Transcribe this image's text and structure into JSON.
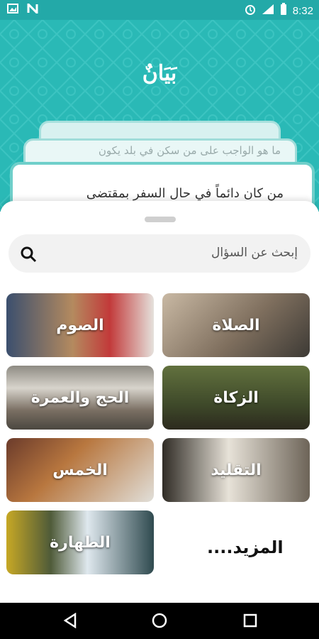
{
  "status": {
    "time": "8:32",
    "network": "LTE"
  },
  "header": {
    "logo": "بَيَانٌ"
  },
  "cards": {
    "back_text": "ما هو الواجب على من سكن في بلد يكون",
    "front_text": "من كان دائماً في حال السفر بمقتضى"
  },
  "search": {
    "placeholder": "إبحث عن السؤال"
  },
  "categories": [
    {
      "label": "الصلاة"
    },
    {
      "label": "الصوم"
    },
    {
      "label": "الزكاة"
    },
    {
      "label": "الحج والعمرة"
    },
    {
      "label": "التقليد"
    },
    {
      "label": "الخمس"
    },
    {
      "label": "الطهارة"
    }
  ],
  "more_label": "المزيد....",
  "colors": {
    "accent": "#2ab9b6",
    "card_border": "#6fcfca"
  }
}
